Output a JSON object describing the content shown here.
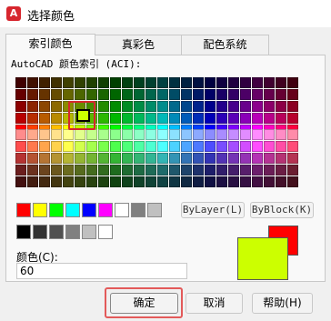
{
  "window": {
    "title": "选择颜色",
    "app_icon_letter": "A"
  },
  "tabs": [
    {
      "label": "索引颜色",
      "active": true
    },
    {
      "label": "真彩色",
      "active": false
    },
    {
      "label": "配色系统",
      "active": false
    }
  ],
  "aci_label": "AutoCAD 颜色索引 (ACI):",
  "palette": {
    "hues": [
      "#ff0000",
      "#ff3f00",
      "#ff7f00",
      "#ffbf00",
      "#ffff00",
      "#bfff00",
      "#7fff00",
      "#3fff00",
      "#00ff00",
      "#00ff3f",
      "#00ff7f",
      "#00ffbf",
      "#00ffff",
      "#00bfff",
      "#007fff",
      "#003fff",
      "#0000ff",
      "#3f00ff",
      "#7f00ff",
      "#bf00ff",
      "#ff00ff",
      "#ff00bf",
      "#ff007f",
      "#ff003f"
    ],
    "selected_index": 60,
    "selected_color": "#ccff00"
  },
  "standard_colors": [
    "#ff0000",
    "#ffff00",
    "#00ff00",
    "#00ffff",
    "#0000ff",
    "#ff00ff",
    "#ffffff",
    "#808080",
    "#c0c0c0"
  ],
  "gray_colors": [
    "#000000",
    "#333333",
    "#505050",
    "#808080",
    "#c0c0c0",
    "#ffffff"
  ],
  "bylayer_label": "ByLayer(L)",
  "byblock_label": "ByBlock(K)",
  "color_field": {
    "label": "颜色(C):",
    "value": "60"
  },
  "preview": {
    "new_color": "#ccff00",
    "old_color": "#ff0000"
  },
  "buttons": {
    "ok": "确定",
    "cancel": "取消",
    "help": "帮助(H)"
  }
}
